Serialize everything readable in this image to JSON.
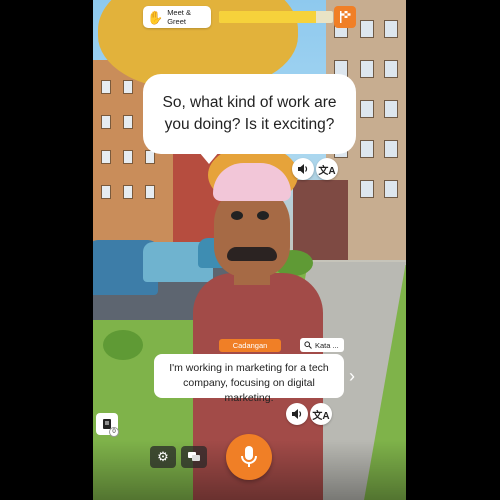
{
  "header": {
    "scenario_label": "Meet & Greet",
    "scenario_icon": "waving-hand-icon",
    "progress_fraction": 0.85,
    "goal_icon": "checkered-flag-icon"
  },
  "npc": {
    "speech": "So, what kind of work are you doing? Is it exciting?",
    "audio_icon": "speaker-icon",
    "translate_icon": "translate-icon"
  },
  "suggestion": {
    "tag": "Cadangan",
    "words_label": "Kata ...",
    "words_icon": "search-icon",
    "answer": "I'm working in marketing for a tech company, focusing on digital marketing.",
    "next_icon": "chevron-right-icon"
  },
  "footer": {
    "notes_badge": "0",
    "notes_icon": "notes-icon",
    "settings_icon": "gear-icon",
    "chat_icon": "chat-icon",
    "mic_icon": "microphone-icon"
  },
  "colors": {
    "accent": "#f07f26",
    "progress": "#f6d23b"
  }
}
